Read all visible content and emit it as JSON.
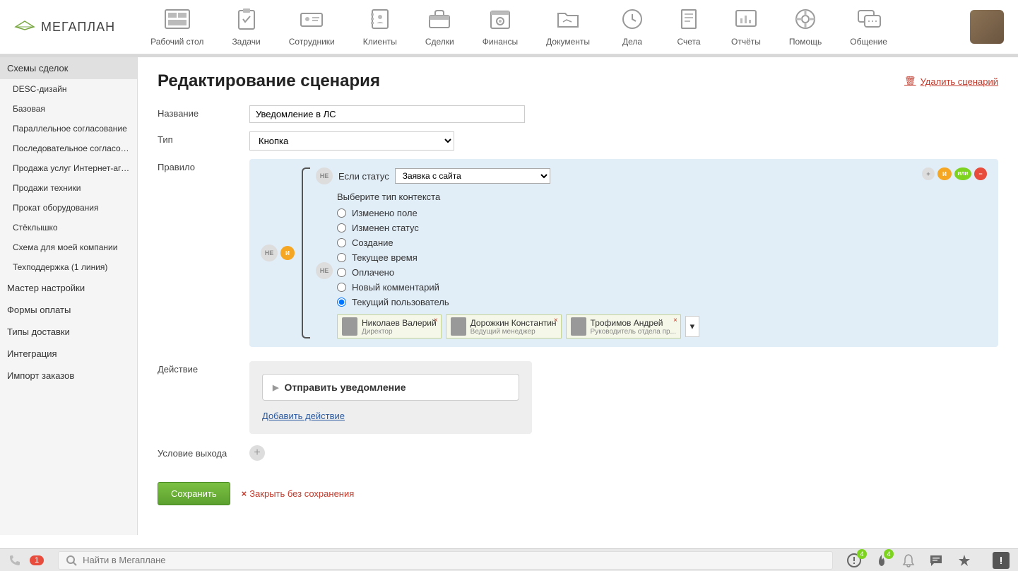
{
  "logo": {
    "text": "МЕГАПЛАН"
  },
  "nav": [
    {
      "label": "Рабочий стол"
    },
    {
      "label": "Задачи"
    },
    {
      "label": "Сотрудники"
    },
    {
      "label": "Клиенты"
    },
    {
      "label": "Сделки"
    },
    {
      "label": "Финансы"
    },
    {
      "label": "Документы"
    },
    {
      "label": "Дела"
    },
    {
      "label": "Счета"
    },
    {
      "label": "Отчёты"
    },
    {
      "label": "Помощь"
    },
    {
      "label": "Общение"
    }
  ],
  "sidebar": {
    "sections": [
      {
        "label": "Схемы сделок",
        "active": true
      },
      {
        "label": "Мастер настройки"
      },
      {
        "label": "Формы оплаты"
      },
      {
        "label": "Типы доставки"
      },
      {
        "label": "Интеграция"
      },
      {
        "label": "Импорт заказов"
      }
    ],
    "sub_items": [
      "DESC-дизайн",
      "Базовая",
      "Параллельное согласование",
      "Последовательное согласов...",
      "Продажа услуг Интернет-аге...",
      "Продажи техники",
      "Прокат оборудования",
      "Стёклышко",
      "Схема для моей компании",
      "Техподдержка (1 линия)"
    ]
  },
  "page": {
    "title": "Редактирование сценария",
    "delete_label": "Удалить сценарий"
  },
  "form": {
    "name_label": "Название",
    "name_value": "Уведомление в ЛС",
    "type_label": "Тип",
    "type_value": "Кнопка",
    "rule_label": "Правило",
    "action_label": "Действие",
    "exit_label": "Условие выхода"
  },
  "rule": {
    "ne": "НЕ",
    "and": "И",
    "or": "ИЛИ",
    "status_label": "Если статус",
    "status_value": "Заявка с сайта",
    "context_label": "Выберите тип контекста",
    "context_options": [
      "Изменено поле",
      "Изменен статус",
      "Создание",
      "Текущее время",
      "Оплачено",
      "Новый комментарий",
      "Текущий пользователь"
    ],
    "context_selected": 6,
    "users": [
      {
        "name": "Николаев Валерий",
        "role": "Директор"
      },
      {
        "name": "Дорожкин Константин",
        "role": "Ведущий менеджер"
      },
      {
        "name": "Трофимов Андрей",
        "role": "Руководитель отдела пр..."
      }
    ]
  },
  "action": {
    "item_label": "Отправить уведомление",
    "add_label": "Добавить действие"
  },
  "buttons": {
    "save": "Сохранить",
    "cancel": "Закрыть без сохранения"
  },
  "footer": {
    "phone_badge": "1",
    "search_placeholder": "Найти в Мегаплане",
    "notif1": "4",
    "notif2": "4"
  }
}
